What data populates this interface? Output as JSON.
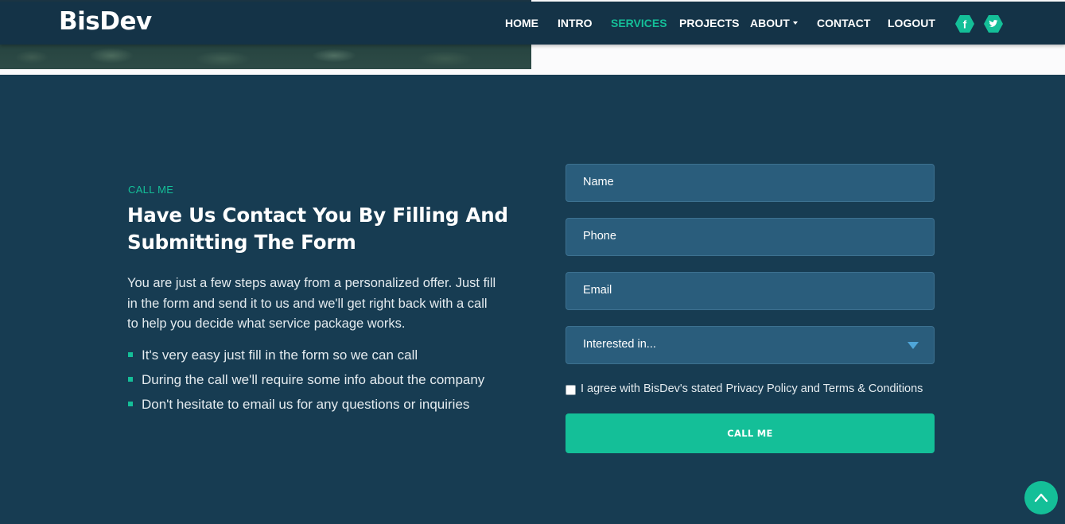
{
  "brand": {
    "logo_text": "BisDev"
  },
  "nav": {
    "items": [
      {
        "label": "HOME",
        "active": false
      },
      {
        "label": "INTRO",
        "active": false
      },
      {
        "label": "SERVICES",
        "active": true
      },
      {
        "label": "PROJECTS",
        "active": false
      },
      {
        "label": "ABOUT",
        "active": false,
        "has_dropdown": true
      },
      {
        "label": "CONTACT",
        "active": false
      },
      {
        "label": "LOGOUT",
        "active": false
      }
    ],
    "social": [
      {
        "icon": "facebook-icon",
        "glyph": "f"
      },
      {
        "icon": "twitter-icon"
      }
    ]
  },
  "callme": {
    "eyebrow": "CALL ME",
    "heading": "Have Us Contact You By Filling And Submitting The Form",
    "paragraph": "You are just a few steps away from a personalized offer. Just fill in the form and send it to us and we'll get right back with a call to help you decide what service package works.",
    "bullets": [
      "It's very easy just fill in the form so we can call",
      "During the call we'll require some info about the company",
      "Don't hesitate to email us for any questions or inquiries"
    ]
  },
  "form": {
    "name_placeholder": "Name",
    "phone_placeholder": "Phone",
    "email_placeholder": "Email",
    "interest_selected": "Interested in...",
    "agree_label": "I agree with BisDev's stated Privacy Policy and Terms & Conditions",
    "agree_checked": false,
    "submit_label": "CALL ME"
  },
  "colors": {
    "accent": "#14bf98",
    "nav_bg": "#143347",
    "section_bg": "#173c52",
    "field_bg": "#2a5d7c"
  },
  "back_to_top": {
    "icon": "chevron-up-icon"
  }
}
